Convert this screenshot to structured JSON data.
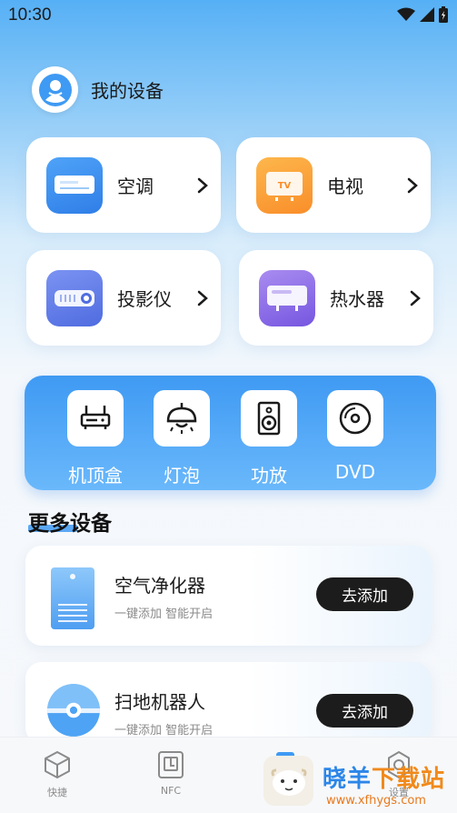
{
  "status_bar": {
    "time": "10:30"
  },
  "header": {
    "title": "我的设备"
  },
  "devices": [
    {
      "label": "空调",
      "icon": "air-conditioner-icon",
      "color": "#3d8ff0"
    },
    {
      "label": "电视",
      "icon": "tv-icon",
      "color": "#fba23a"
    },
    {
      "label": "投影仪",
      "icon": "projector-icon",
      "color": "#5a79e8"
    },
    {
      "label": "热水器",
      "icon": "water-heater-icon",
      "color": "#8b6ee6"
    }
  ],
  "quick_devices": [
    {
      "label": "机顶盒",
      "icon": "set-top-box-icon"
    },
    {
      "label": "灯泡",
      "icon": "lamp-icon"
    },
    {
      "label": "功放",
      "icon": "speaker-icon"
    },
    {
      "label": "DVD",
      "icon": "disc-icon"
    }
  ],
  "more": {
    "title": "更多设备",
    "items": [
      {
        "name": "空气净化器",
        "desc": "一键添加  智能开启",
        "button": "去添加",
        "icon": "air-purifier-icon"
      },
      {
        "name": "扫地机器人",
        "desc": "一键添加  智能开启",
        "button": "去添加",
        "icon": "robot-vacuum-icon"
      }
    ]
  },
  "tabs": [
    {
      "label": "快捷",
      "icon": "cube-icon"
    },
    {
      "label": "NFC",
      "icon": "nfc-icon"
    },
    {
      "label": "",
      "icon": "remote-icon"
    },
    {
      "label": "设置",
      "icon": "settings-icon"
    }
  ],
  "watermark": {
    "title_part1": "晓羊",
    "title_part2": "下载站",
    "url": "www.xfhygs.com"
  },
  "colors": {
    "accent": "#3f9af3",
    "dark_button": "#1c1c1c"
  }
}
